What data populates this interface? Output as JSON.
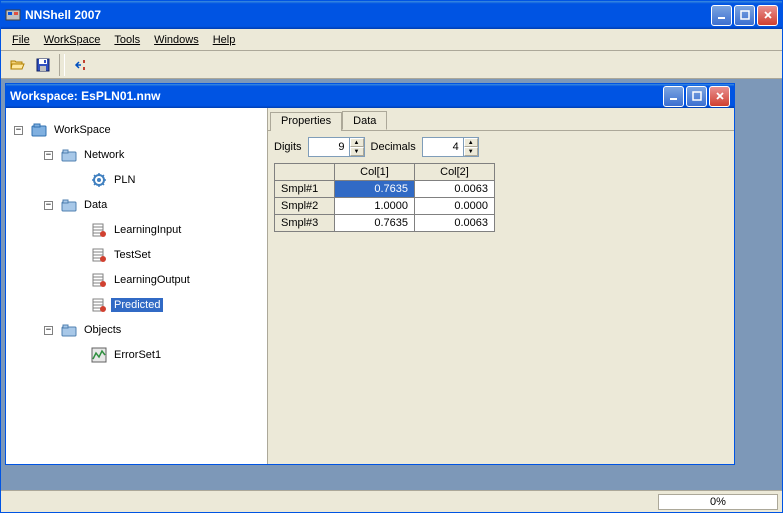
{
  "app": {
    "title": "NNShell 2007"
  },
  "menu": {
    "file": "File",
    "workspace": "WorkSpace",
    "tools": "Tools",
    "windows": "Windows",
    "help": "Help"
  },
  "child": {
    "title": "Workspace: EsPLN01.nnw"
  },
  "tree": {
    "root": "WorkSpace",
    "network": "Network",
    "pln": "PLN",
    "data": "Data",
    "learning_input": "LearningInput",
    "testset": "TestSet",
    "learning_output": "LearningOutput",
    "predicted": "Predicted",
    "objects": "Objects",
    "errorset": "ErrorSet1"
  },
  "tabs": {
    "properties": "Properties",
    "data": "Data"
  },
  "controls": {
    "digits_label": "Digits",
    "digits_value": "9",
    "decimals_label": "Decimals",
    "decimals_value": "4"
  },
  "table": {
    "col1": "Col[1]",
    "col2": "Col[2]",
    "rows": [
      {
        "name": "Smpl#1",
        "c1": "0.7635",
        "c2": "0.0063"
      },
      {
        "name": "Smpl#2",
        "c1": "1.0000",
        "c2": "0.0000"
      },
      {
        "name": "Smpl#3",
        "c1": "0.7635",
        "c2": "0.0063"
      }
    ]
  },
  "status": {
    "progress": "0%"
  }
}
